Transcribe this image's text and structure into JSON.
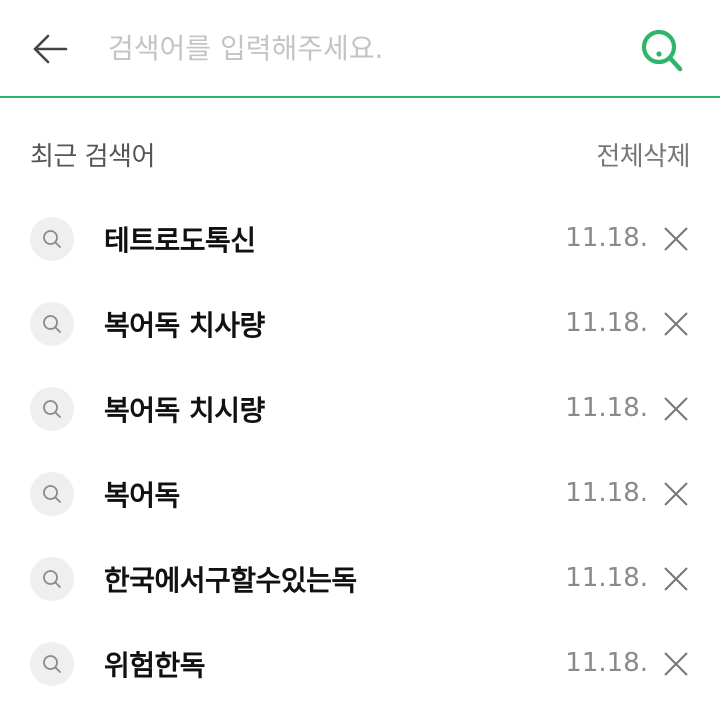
{
  "search": {
    "placeholder": "검색어를 입력해주세요.",
    "value": "",
    "accent_color": "#2db56a"
  },
  "icons": {
    "back": "back-arrow-icon",
    "search": "search-icon",
    "item": "search-icon",
    "delete": "close-icon"
  },
  "recent": {
    "title": "최근 검색어",
    "clear_all_label": "전체삭제",
    "items": [
      {
        "keyword": "테트로도톡신",
        "date": "11.18."
      },
      {
        "keyword": "복어독 치사량",
        "date": "11.18."
      },
      {
        "keyword": "복어독 치시량",
        "date": "11.18."
      },
      {
        "keyword": "복어독",
        "date": "11.18."
      },
      {
        "keyword": "한국에서구할수있는독",
        "date": "11.18."
      },
      {
        "keyword": "위험한독",
        "date": "11.18."
      }
    ]
  }
}
